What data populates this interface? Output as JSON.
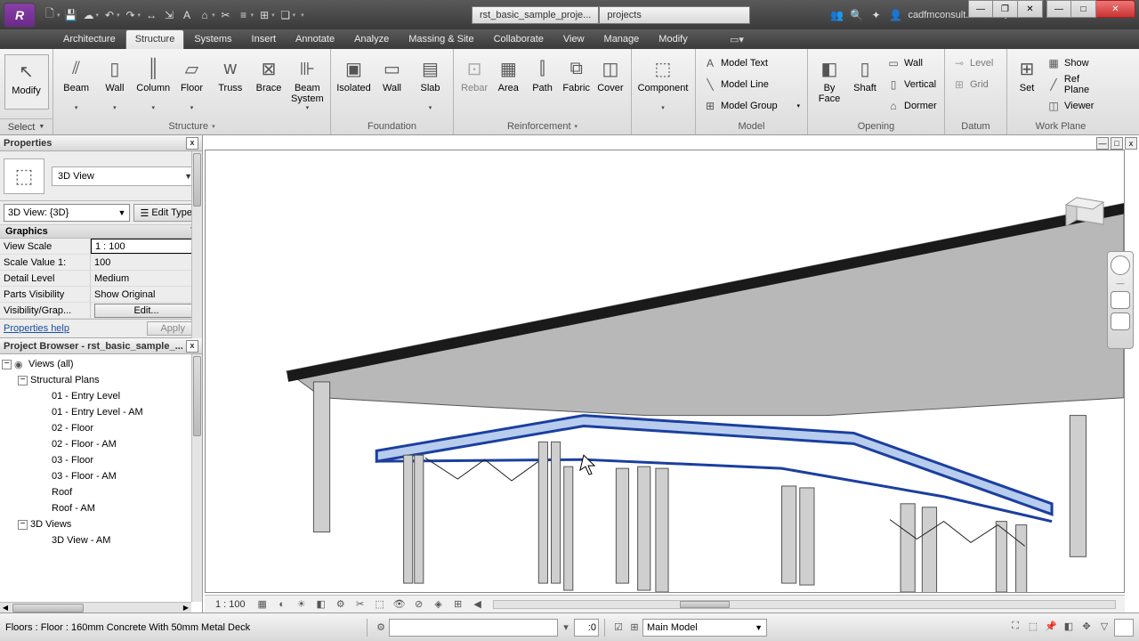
{
  "window": {
    "title_segment1": "rst_basic_sample_proje...",
    "title_segment2": "projects",
    "user_label": "cadfmconsult..."
  },
  "ribbon": {
    "tabs": [
      "Architecture",
      "Structure",
      "Systems",
      "Insert",
      "Annotate",
      "Analyze",
      "Massing & Site",
      "Collaborate",
      "View",
      "Manage",
      "Modify"
    ],
    "active_tab": "Structure",
    "select_label": "Select",
    "panels": {
      "modify": {
        "title": "",
        "button": "Modify"
      },
      "structure": {
        "title": "Structure",
        "buttons": [
          "Beam",
          "Wall",
          "Column",
          "Floor",
          "Truss",
          "Brace",
          "Beam System"
        ]
      },
      "foundation": {
        "title": "Foundation",
        "buttons": [
          "Isolated",
          "Wall",
          "Slab"
        ]
      },
      "reinforcement": {
        "title": "Reinforcement",
        "buttons": [
          "Rebar",
          "Area",
          "Path",
          "Fabric",
          "Cover"
        ]
      },
      "component": {
        "title": "",
        "button": "Component"
      },
      "model": {
        "title": "Model",
        "rows": [
          "Model Text",
          "Model Line",
          "Model Group"
        ]
      },
      "opening": {
        "title": "Opening",
        "buttons": [
          "By Face",
          "Shaft"
        ],
        "rows": [
          "Wall",
          "Vertical",
          "Dormer"
        ]
      },
      "datum": {
        "title": "Datum",
        "rows": [
          "Level",
          "Grid"
        ]
      },
      "workplane": {
        "title": "Work Plane",
        "button": "Set",
        "rows": [
          "Show",
          "Ref Plane",
          "Viewer"
        ]
      }
    }
  },
  "properties": {
    "title": "Properties",
    "type_name": "3D View",
    "instance_label": "3D View: {3D}",
    "edit_type": "Edit Type",
    "group": "Graphics",
    "rows": {
      "view_scale": {
        "k": "View Scale",
        "v": "1 : 100"
      },
      "scale_value": {
        "k": "Scale Value    1:",
        "v": "100"
      },
      "detail_level": {
        "k": "Detail Level",
        "v": "Medium"
      },
      "parts_vis": {
        "k": "Parts Visibility",
        "v": "Show Original"
      },
      "vis_graphics": {
        "k": "Visibility/Grap...",
        "v": "Edit..."
      }
    },
    "help": "Properties help",
    "apply": "Apply"
  },
  "browser": {
    "title": "Project Browser - rst_basic_sample_...",
    "root": "Views (all)",
    "group1": "Structural Plans",
    "items1": [
      "01 - Entry Level",
      "01 - Entry Level - AM",
      "02 - Floor",
      "02 - Floor - AM",
      "03 - Floor",
      "03 - Floor - AM",
      "Roof",
      "Roof - AM"
    ],
    "group2": "3D Views",
    "items2": [
      "3D View - AM"
    ]
  },
  "viewbar": {
    "scale": "1 : 100"
  },
  "status": {
    "message": "Floors : Floor : 160mm Concrete With 50mm Metal Deck",
    "worksharing_value": ":0",
    "model_dd": "Main Model"
  }
}
